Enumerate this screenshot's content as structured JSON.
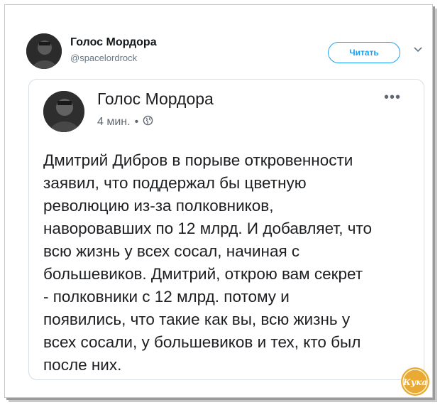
{
  "outer": {
    "name": "Голос Мордора",
    "handle": "@spacelordrock",
    "follow_label": "Читать"
  },
  "post": {
    "author": "Голос Мордора",
    "time": "4 мин.",
    "dot": "•",
    "more": "•••",
    "text": "Дмитрий Дибров в порыве откровенности\nзаявил, что поддержал бы цветную\nреволюцию из-за полковников,\nнаворовавших по 12 млрд. И добавляет, что\nвсю жизнь у всех сосал, начиная с\nбольшевиков. Дмитрий, открою вам секрет\n- полковники с 12 млрд. потому и\nпоявились, что такие как вы, всю жизнь у\nвсех сосали, у большевиков и тех, кто был\nпосле них."
  },
  "watermark": {
    "text": "Кука"
  },
  "colors": {
    "accent": "#1da1f2",
    "watermark": "#e8a935"
  },
  "icons": {
    "globe": "globe-icon",
    "caret": "chevron-down-icon",
    "more": "more-icon"
  }
}
